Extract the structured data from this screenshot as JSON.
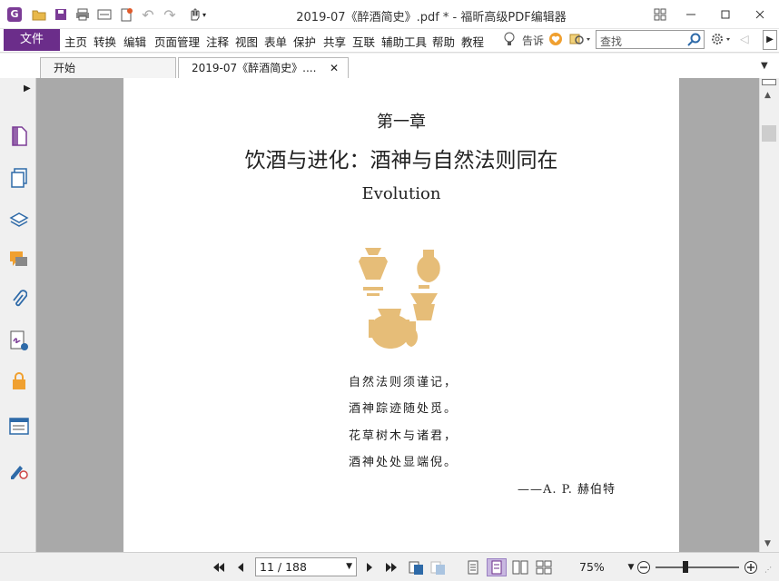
{
  "app": {
    "icon_letter": "G",
    "title": "2019-07《醉酒简史》.pdf * - 福昕高级PDF编辑器"
  },
  "menu": {
    "file": "文件",
    "items": [
      "主页",
      "转换",
      "编辑",
      "页面管理",
      "注释",
      "视图",
      "表单",
      "保护",
      "共享",
      "互联",
      "辅助工具",
      "帮助",
      "教程"
    ],
    "tell": "告诉",
    "search_placeholder": "查找"
  },
  "tabs": [
    {
      "label": "开始"
    },
    {
      "label": "2019-07《醉酒简史》....",
      "close": "✕"
    }
  ],
  "document": {
    "chapter": "第一章",
    "heading": "饮酒与进化：酒神与自然法则同在",
    "subtitle": "Evolution",
    "poem": [
      "自然法则须谨记，",
      "酒神踪迹随处觅。",
      "花草树木与诸君，",
      "酒神处处显端倪。"
    ],
    "attribution": "——A. P. 赫伯特",
    "vase_color": "#e6bd78"
  },
  "status": {
    "page_indicator": "11 / 188",
    "zoom": "75%"
  },
  "colors": {
    "accent": "#6b2d8a",
    "workspace": "#a9a9a9"
  }
}
